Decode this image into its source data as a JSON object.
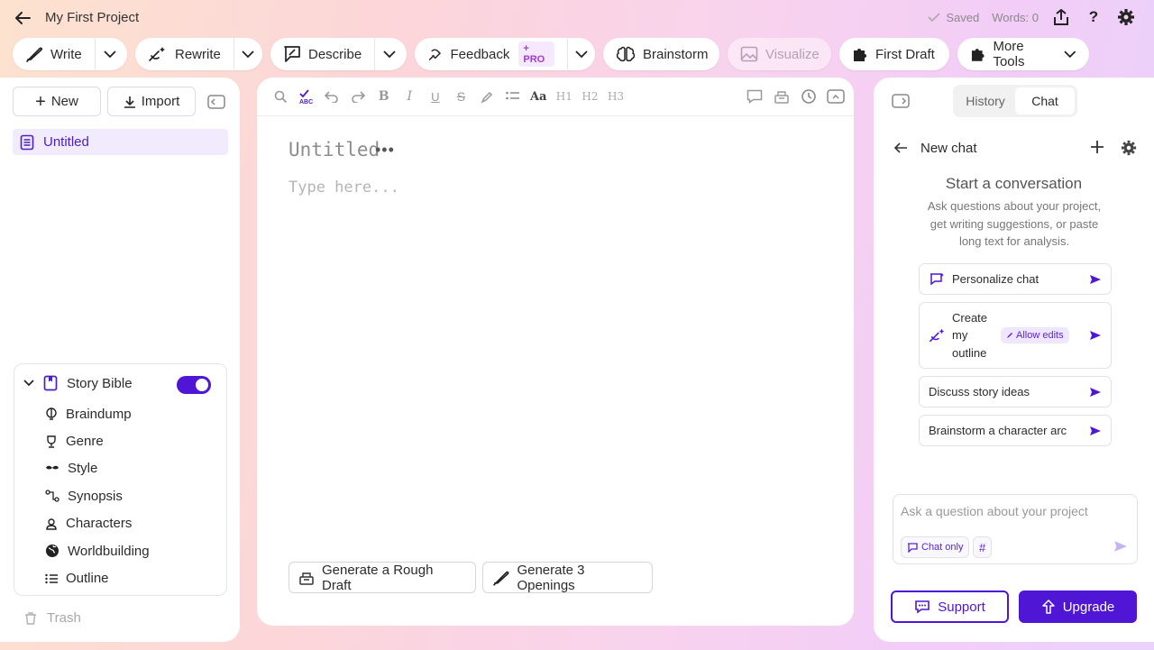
{
  "header": {
    "project_title": "My First Project",
    "saved": "Saved",
    "words": "Words: 0"
  },
  "toolbar": {
    "write": "Write",
    "rewrite": "Rewrite",
    "describe": "Describe",
    "feedback": "Feedback",
    "pro_badge": "+ PRO",
    "brainstorm": "Brainstorm",
    "visualize": "Visualize",
    "first_draft": "First Draft",
    "more_tools": "More Tools"
  },
  "left": {
    "new": "New",
    "import": "Import",
    "doc": "Untitled",
    "story_bible": "Story Bible",
    "story_bible_enabled": true,
    "items": [
      "Braindump",
      "Genre",
      "Style",
      "Synopsis",
      "Characters",
      "Worldbuilding",
      "Outline"
    ],
    "trash": "Trash"
  },
  "editor": {
    "format_labels": {
      "case": "Aa",
      "h1": "H1",
      "h2": "H2",
      "h3": "H3"
    },
    "doc_title": "Untitled",
    "placeholder": "Type here...",
    "gen_rough": "Generate a Rough Draft",
    "gen_openings": "Generate 3 Openings"
  },
  "right": {
    "tab_history": "History",
    "tab_chat": "Chat",
    "active_tab": "Chat",
    "chat_title": "New chat",
    "start_title": "Start a conversation",
    "start_sub": "Ask questions about your project, get writing suggestions, or paste long text for analysis.",
    "suggestions": [
      "Personalize chat",
      "Create my outline",
      "Discuss story ideas",
      "Brainstorm a character arc"
    ],
    "allow_edits": "Allow edits",
    "input_placeholder": "Ask a question about your project",
    "chat_only": "Chat only",
    "hash": "#",
    "support": "Support",
    "upgrade": "Upgrade"
  },
  "colors": {
    "accent": "#4f16d6",
    "accent_light": "#f1ebfd",
    "pro": "#a23ad6"
  }
}
